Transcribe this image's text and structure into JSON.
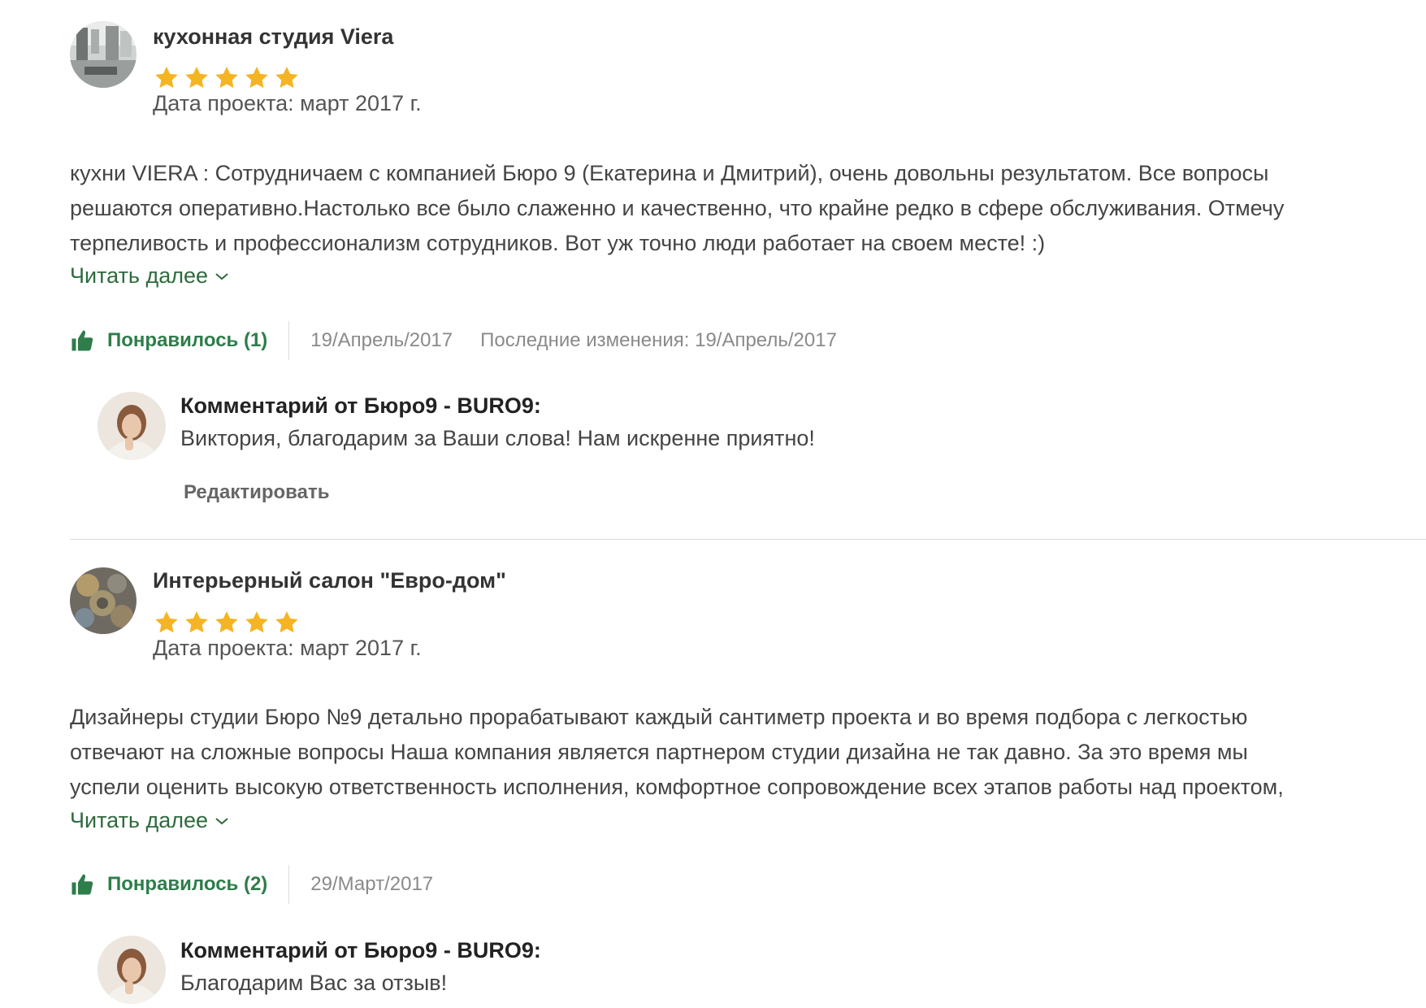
{
  "reviews": [
    {
      "author": "кухонная студия Viera",
      "rating": 5,
      "project_date": "Дата проекта: март 2017 г.",
      "text_lines": [
        "кухни VIERA : Сотрудничаем с компанией Бюро 9 (Екатерина и Дмитрий), очень довольны результатом. Все вопросы",
        "решаются оперативно.Настолько все было слаженно и качественно, что крайне редко в сфере обслуживания. Отмечу",
        "терпеливость и профессионализм сотрудников.  Вот уж точно люди работает на своем месте! :)"
      ],
      "read_more": "Читать далее",
      "like_label": "Понравилось (1)",
      "date": "19/Апрель/2017",
      "edited": "Последние изменения:  19/Апрель/2017",
      "reply": {
        "title": "Комментарий от Бюро9 - BURO9:",
        "text": "Виктория, благодарим за Ваши слова! Нам искренне приятно!",
        "edit_label": "Редактировать"
      }
    },
    {
      "author": "Интерьерный салон \"Евро-дом\"",
      "rating": 5,
      "project_date": "Дата проекта: март 2017 г.",
      "text_lines": [
        "Дизайнеры студии Бюро №9 детально прорабатывают каждый сантиметр проекта и во время подбора с легкостью",
        "отвечают на сложные вопросы Наша компания является партнером студии дизайна не так давно. За это время мы",
        "успели оценить высокую ответственность исполнения, комфортное сопровождение всех этапов работы над проектом,"
      ],
      "read_more": "Читать далее",
      "like_label": "Понравилось (2)",
      "date": "29/Март/2017",
      "reply": {
        "title": "Комментарий от Бюро9 - BURO9:",
        "text": "Благодарим Вас за отзыв!"
      }
    }
  ],
  "colors": {
    "star": "#f5b423",
    "accent_green": "#2e7d4a",
    "link_green": "#2e6b3d",
    "muted": "#8a8a8a"
  },
  "icons": {
    "like": "thumbs-up-icon",
    "chevron": "chevron-down-icon",
    "star": "star-icon"
  }
}
